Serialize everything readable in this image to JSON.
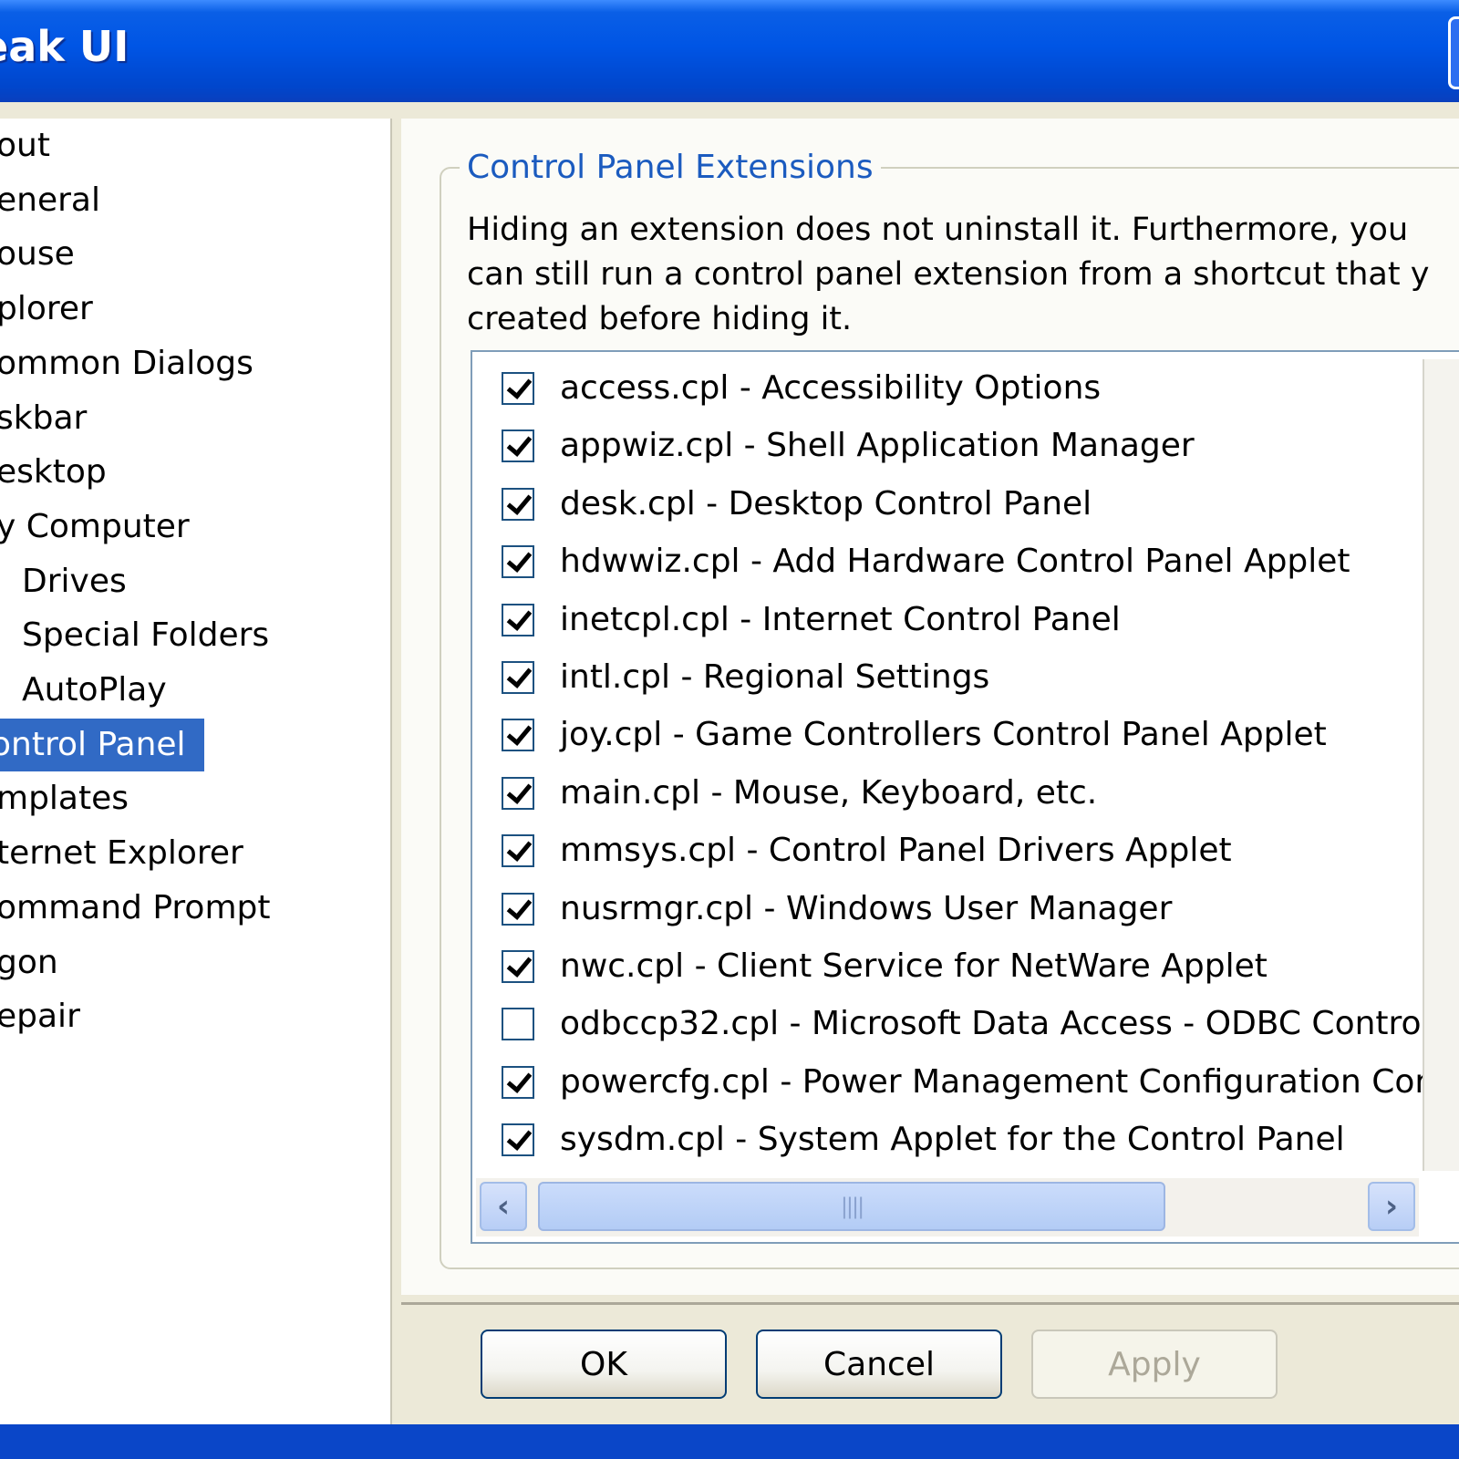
{
  "window": {
    "title": "eak UI"
  },
  "tree": {
    "items": [
      {
        "label": "out"
      },
      {
        "label": "eneral"
      },
      {
        "label": "ouse"
      },
      {
        "label": "plorer"
      },
      {
        "label": "ommon Dialogs"
      },
      {
        "label": "skbar"
      },
      {
        "label": "esktop"
      },
      {
        "label": "y Computer"
      },
      {
        "label": "Drives"
      },
      {
        "label": "Special Folders"
      },
      {
        "label": "AutoPlay"
      },
      {
        "label": "ontrol Panel",
        "selected": true
      },
      {
        "label": "mplates"
      },
      {
        "label": "ternet Explorer"
      },
      {
        "label": "ommand Prompt"
      },
      {
        "label": "gon"
      },
      {
        "label": "epair"
      }
    ]
  },
  "panel": {
    "group_title": "Control Panel Extensions",
    "description_lines": [
      "Hiding an extension does not uninstall it. Furthermore, you",
      "can still run a control panel extension from a shortcut that y",
      "created before hiding it."
    ],
    "extensions": [
      {
        "label": "access.cpl - Accessibility Options",
        "checked": true
      },
      {
        "label": "appwiz.cpl - Shell Application Manager",
        "checked": true
      },
      {
        "label": "desk.cpl - Desktop Control Panel",
        "checked": true
      },
      {
        "label": "hdwwiz.cpl - Add Hardware Control Panel Applet",
        "checked": true
      },
      {
        "label": "inetcpl.cpl - Internet Control Panel",
        "checked": true
      },
      {
        "label": "intl.cpl - Regional Settings",
        "checked": true
      },
      {
        "label": "joy.cpl - Game Controllers Control Panel Applet",
        "checked": true
      },
      {
        "label": "main.cpl - Mouse, Keyboard, etc.",
        "checked": true
      },
      {
        "label": "mmsys.cpl - Control Panel Drivers Applet",
        "checked": true
      },
      {
        "label": "nusrmgr.cpl - Windows User Manager",
        "checked": true
      },
      {
        "label": "nwc.cpl - Client Service for NetWare Applet",
        "checked": true
      },
      {
        "label": "odbccp32.cpl - Microsoft Data Access - ODBC Contro",
        "checked": false
      },
      {
        "label": "powercfg.cpl - Power Management Configuration Cor",
        "checked": true
      },
      {
        "label": "sysdm.cpl - System Applet for the Control Panel",
        "checked": true
      }
    ]
  },
  "icons": {
    "scroll_left": "chevron-left-icon",
    "scroll_right": "chevron-right-icon",
    "thumb_grip": "grip-icon"
  },
  "buttons": {
    "ok": "OK",
    "cancel": "Cancel",
    "apply": "Apply"
  },
  "colors": {
    "title_bar": "#0055E5",
    "selection": "#316AC5",
    "group_title": "#1B5BBF"
  }
}
